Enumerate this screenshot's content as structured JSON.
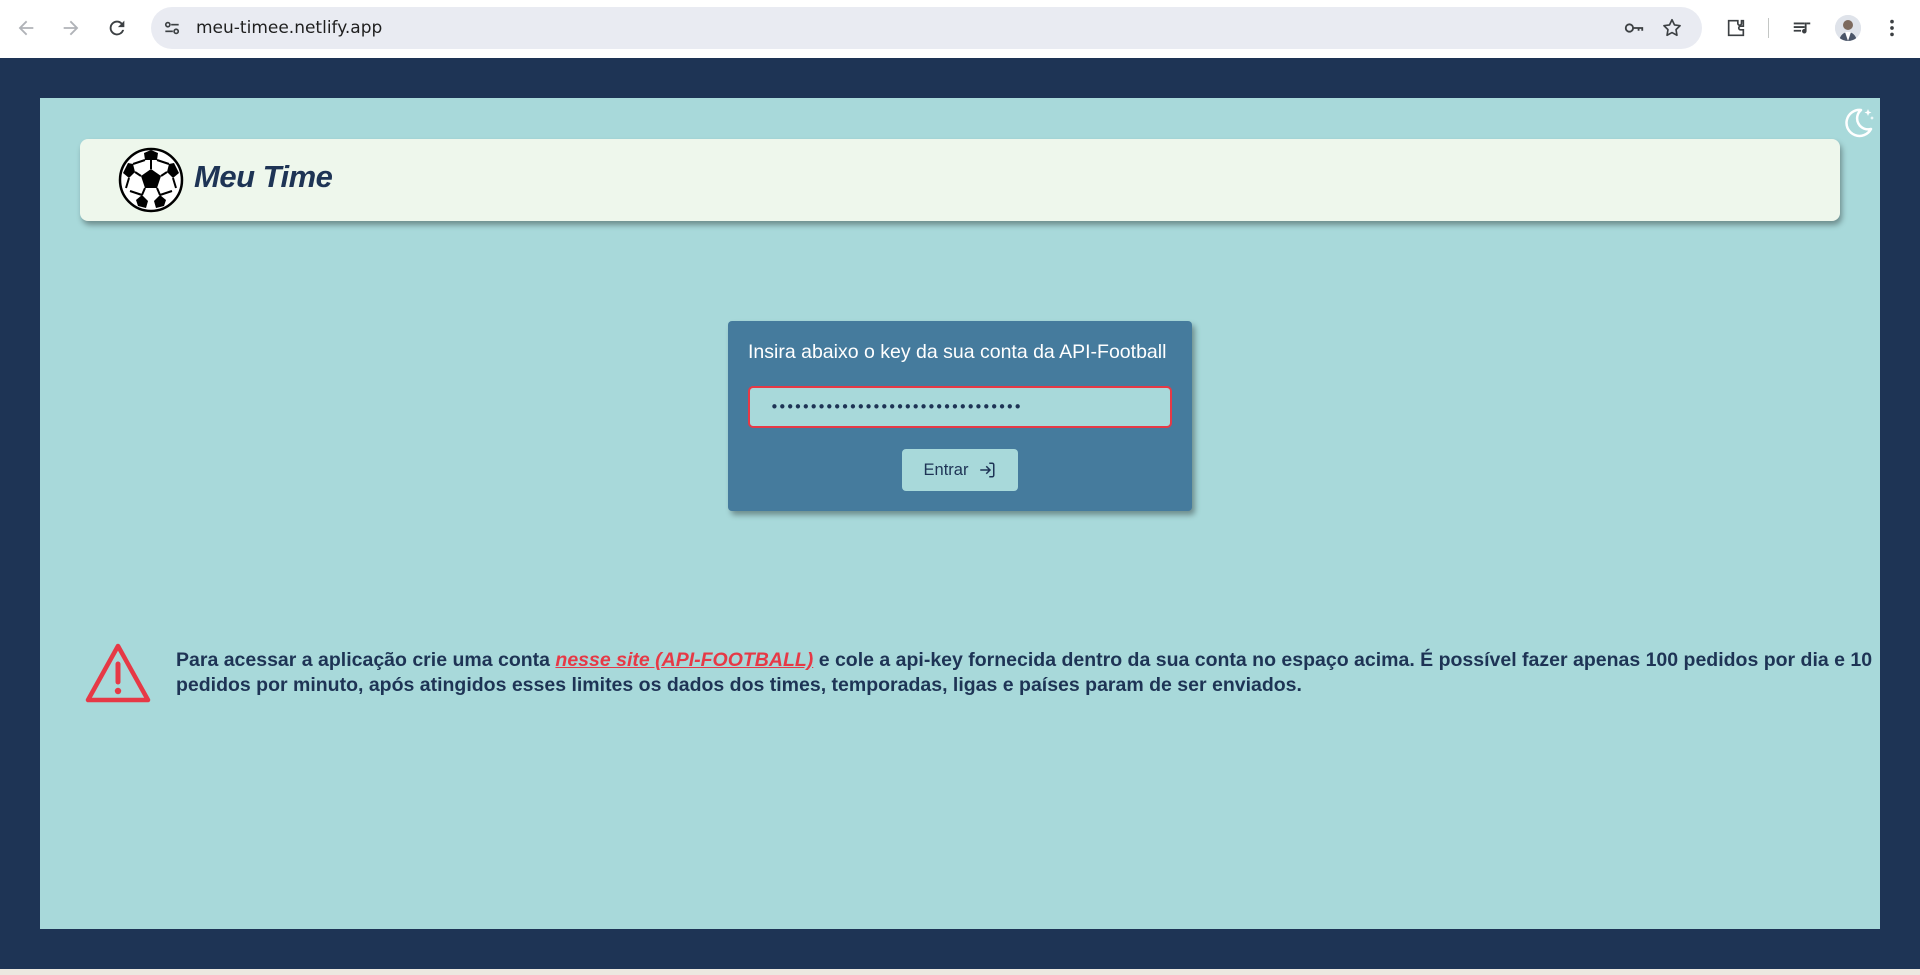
{
  "browser": {
    "url": "meu-timee.netlify.app"
  },
  "app": {
    "title": "Meu Time"
  },
  "login": {
    "prompt": "Insira abaixo o key da sua conta da API-Football",
    "key_value": "••••••••••••••••••••••••••••••••",
    "submit_label": "Entrar"
  },
  "notice": {
    "text_before": "Para acessar a aplicação crie uma conta ",
    "link_text": "nesse site (API-FOOTBALL)",
    "text_after": " e cole a api-key fornecida dentro da sua conta no espaço acima. É possível fazer apenas 100 pedidos por dia e 10 pedidos por minuto, após atingidos esses limites os dados dos times, temporadas, ligas e países param de ser enviados."
  },
  "colors": {
    "frame": "#1e3455",
    "page_bg": "#a8d9da",
    "header_bg": "#eef7ec",
    "card_bg": "#457b9d",
    "accent_red": "#e63946"
  },
  "icons": {
    "logo": "soccer-ball-icon",
    "theme": "moon-stars-icon",
    "warning": "warning-triangle-icon",
    "login": "log-in-icon"
  }
}
